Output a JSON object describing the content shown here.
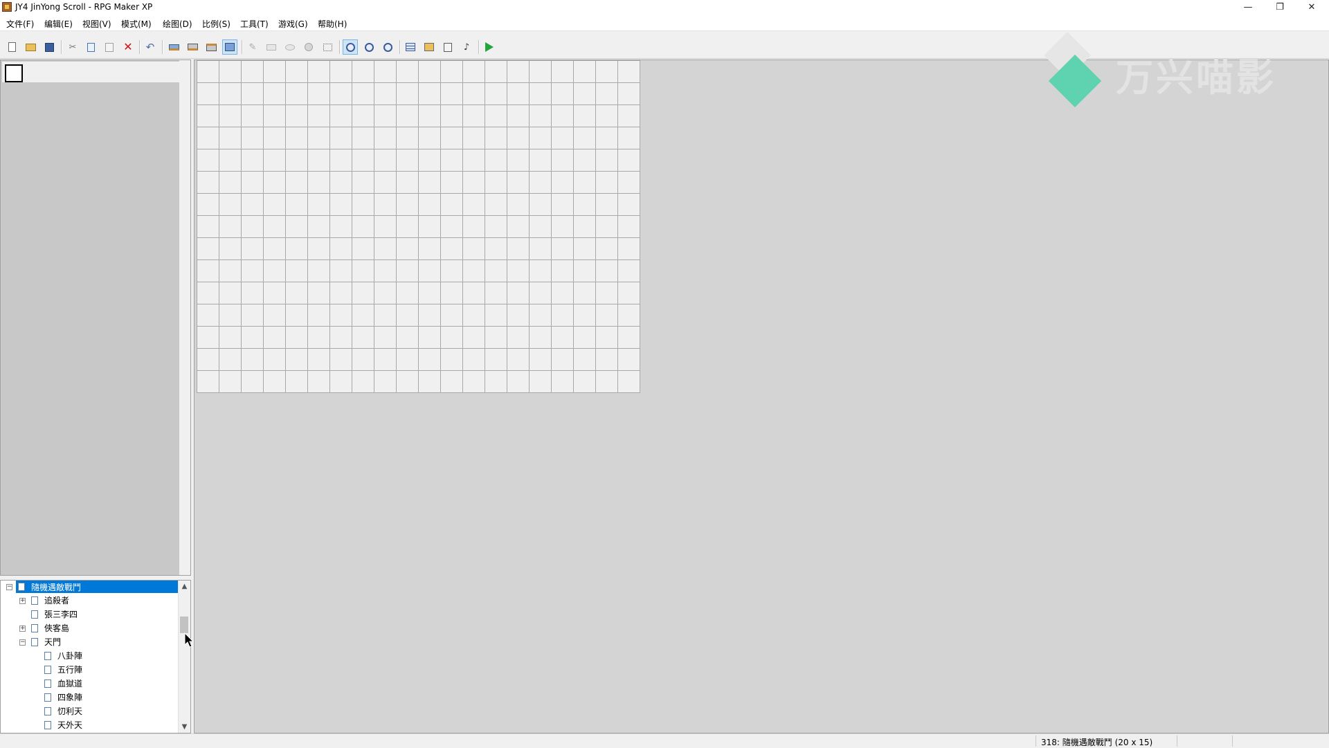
{
  "window": {
    "title": "JY4 JinYong Scroll - RPG Maker XP",
    "minimize": "—",
    "restore": "❐",
    "close": "✕"
  },
  "menu": [
    {
      "label": "文件(F)"
    },
    {
      "label": "编辑(E)"
    },
    {
      "label": "视图(V)"
    },
    {
      "label": "模式(M)"
    },
    {
      "label": "绘图(D)"
    },
    {
      "label": "比例(S)"
    },
    {
      "label": "工具(T)"
    },
    {
      "label": "游戏(G)"
    },
    {
      "label": "帮助(H)"
    }
  ],
  "toolbar": {
    "icons": [
      "new-project-icon",
      "open-project-icon",
      "save-icon",
      "cut-icon",
      "copy-icon",
      "paste-icon",
      "delete-icon",
      "undo-icon",
      "layer1-icon",
      "layer2-icon",
      "layer3-icon",
      "events-layer-icon",
      "pencil-icon",
      "rectangle-icon",
      "ellipse-icon",
      "fill-icon",
      "select-icon",
      "zoom-1-1-icon",
      "zoom-1-2-icon",
      "zoom-1-4-icon",
      "database-icon",
      "materialbase-icon",
      "script-editor-icon",
      "sound-test-icon",
      "playtest-icon"
    ]
  },
  "tree": {
    "items": [
      {
        "label": "隨機遇敵戰鬥",
        "selected": true,
        "expander": "−"
      },
      {
        "label": "追殺者",
        "expander": "+"
      },
      {
        "label": "張三李四",
        "expander": ""
      },
      {
        "label": "俠客島",
        "expander": "+"
      },
      {
        "label": "天門",
        "expander": "−"
      },
      {
        "label": "八卦陣",
        "expander": ""
      },
      {
        "label": "五行陣",
        "expander": ""
      },
      {
        "label": "血獄道",
        "expander": ""
      },
      {
        "label": "四象陣",
        "expander": ""
      },
      {
        "label": "忉利天",
        "expander": ""
      },
      {
        "label": "天外天",
        "expander": ""
      }
    ]
  },
  "map": {
    "width_tiles": 20,
    "height_tiles": 15
  },
  "watermark": {
    "text": "万兴喵影"
  },
  "status": {
    "text": "318: 隨機遇敵戰鬥 (20 x 15)"
  }
}
